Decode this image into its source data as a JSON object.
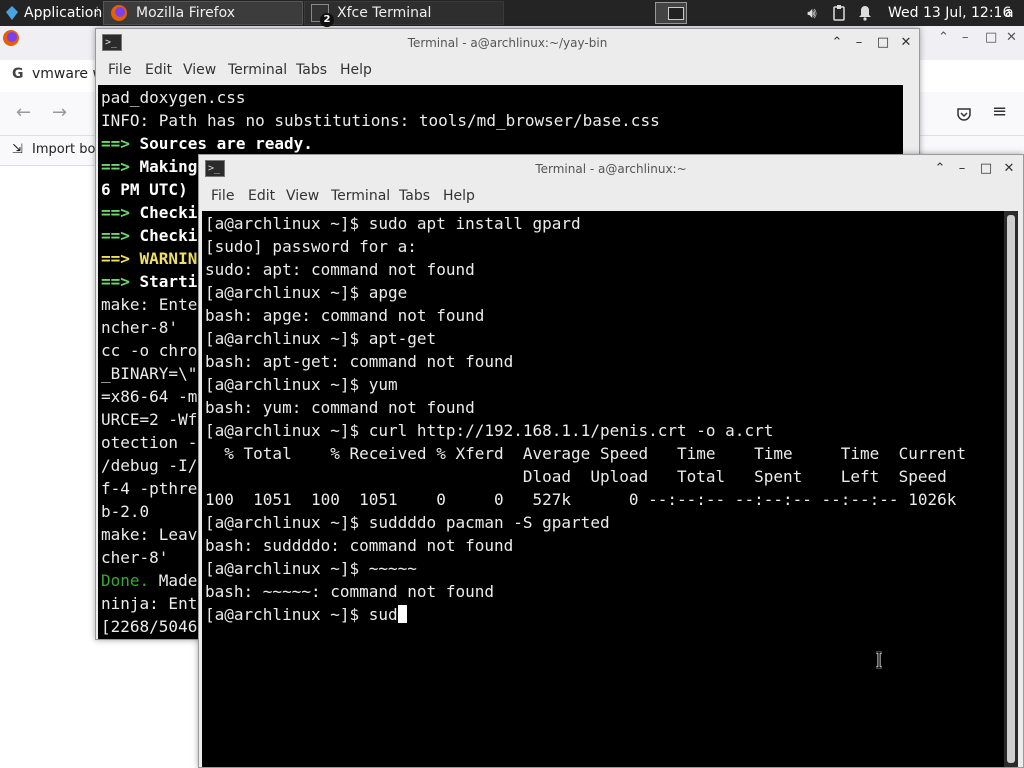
{
  "panel": {
    "applications_label": "Applications",
    "tasks": [
      {
        "label": "Mozilla Firefox",
        "icon": "firefox-icon",
        "state": "active"
      },
      {
        "label": "Xfce Terminal",
        "icon": "terminal-icon",
        "badge": "2",
        "state": "inactive"
      }
    ],
    "clock": "Wed 13 Jul, 12:16",
    "user": "a",
    "tray_icons": [
      "volume-icon",
      "clipboard-icon",
      "notifications-icon",
      "power-icon"
    ]
  },
  "firefox": {
    "tab_label": "vmware w",
    "bookmark_label": "Import bo"
  },
  "back_terminal": {
    "title": "Terminal - a@archlinux:~/yay-bin",
    "menu": [
      "File",
      "Edit",
      "View",
      "Terminal",
      "Tabs",
      "Help"
    ],
    "lines": [
      [
        {
          "t": "pad_doxygen.css"
        }
      ],
      [
        {
          "t": "INFO: Path has no substitutions: tools/md_browser/base.css"
        }
      ],
      [
        {
          "t": "==> ",
          "c": "g"
        },
        {
          "t": "Sources are ready.",
          "c": "w"
        }
      ],
      [
        {
          "t": "==> ",
          "c": "g"
        },
        {
          "t": "Making",
          "c": "w"
        }
      ],
      [
        {
          "t": "6 PM UTC)",
          "c": "w"
        }
      ],
      [
        {
          "t": "==> ",
          "c": "g"
        },
        {
          "t": "Checki",
          "c": "w"
        }
      ],
      [
        {
          "t": "==> ",
          "c": "g"
        },
        {
          "t": "Checki",
          "c": "w"
        }
      ],
      [
        {
          "t": "==> ",
          "c": "y"
        },
        {
          "t": "WARNIN",
          "c": "y"
        }
      ],
      [
        {
          "t": "==> ",
          "c": "g"
        },
        {
          "t": "Starti",
          "c": "w"
        }
      ],
      [
        {
          "t": "make: Ente"
        }
      ],
      [
        {
          "t": "ncher-8'"
        }
      ],
      [
        {
          "t": "cc -o chro"
        }
      ],
      [
        {
          "t": "_BINARY=\\\""
        }
      ],
      [
        {
          "t": "=x86-64 -m"
        }
      ],
      [
        {
          "t": "URCE=2 -Wf"
        }
      ],
      [
        {
          "t": "otection -"
        }
      ],
      [
        {
          "t": "/debug -I/"
        }
      ],
      [
        {
          "t": "f-4 -pthre"
        }
      ],
      [
        {
          "t": "b-2.0"
        }
      ],
      [
        {
          "t": "make: Leav"
        }
      ],
      [
        {
          "t": "cher-8'"
        }
      ],
      [
        {
          "t": "Done. ",
          "c": "dg"
        },
        {
          "t": "Made"
        }
      ],
      [
        {
          "t": "ninja: Ent"
        }
      ],
      [
        {
          "t": "[2268/5046"
        }
      ]
    ]
  },
  "front_terminal": {
    "title": "Terminal - a@archlinux:~",
    "menu": [
      "File",
      "Edit",
      "View",
      "Terminal",
      "Tabs",
      "Help"
    ],
    "lines": [
      "[a@archlinux ~]$ sudo apt install gpard",
      "[sudo] password for a:",
      "sudo: apt: command not found",
      "[a@archlinux ~]$ apge",
      "bash: apge: command not found",
      "[a@archlinux ~]$ apt-get",
      "bash: apt-get: command not found",
      "[a@archlinux ~]$ yum",
      "bash: yum: command not found",
      "[a@archlinux ~]$ curl http://192.168.1.1/penis.crt -o a.crt",
      "  % Total    % Received % Xferd  Average Speed   Time    Time     Time  Current",
      "                                 Dload  Upload   Total   Spent    Left  Speed",
      "100  1051  100  1051    0     0   527k      0 --:--:-- --:--:-- --:--:-- 1026k",
      "[a@archlinux ~]$ suddddo pacman -S gparted",
      "bash: suddddo: command not found",
      "[a@archlinux ~]$ ~~~~~",
      "bash: ~~~~~: command not found",
      "[a@archlinux ~]$ sud"
    ]
  }
}
